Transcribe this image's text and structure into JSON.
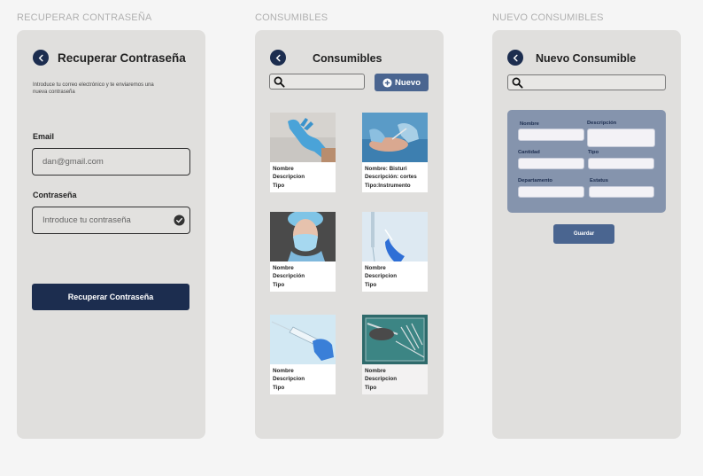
{
  "screens": {
    "recover": {
      "frame_label": "RECUPERAR CONTRASEÑA",
      "title": "Recuperar Contraseña",
      "subtitle_line1": "Introduce tu correo electrónico y te enviaremos una",
      "subtitle_line2": "nueva contraseña",
      "email_label": "Email",
      "email_value": "dan@gmail.com",
      "password_label": "Contraseña",
      "password_placeholder": "Introduce tu contraseña",
      "submit_label": "Recuperar Contraseña"
    },
    "list": {
      "frame_label": "CONSUMIBLES",
      "title": "Consumibles",
      "new_label": "Nuevo",
      "cards": [
        {
          "image": "gloves",
          "line1": "Nombre",
          "line2": "Descripcion",
          "line3": "Tipo"
        },
        {
          "image": "surgery",
          "line1": "Nombre: Bisturi",
          "line2": "Descripción: cortes",
          "line3": "Tipo:Instrumento"
        },
        {
          "image": "mask",
          "line1": "Nombre",
          "line2": "Descripción",
          "line3": "Tipo"
        },
        {
          "image": "iv-drip",
          "line1": "Nombre",
          "line2": "Descripcion",
          "line3": "Tipo"
        },
        {
          "image": "syringe",
          "line1": "Nombre",
          "line2": "Descripcion",
          "line3": "Tipo"
        },
        {
          "image": "instruments",
          "line1": "Nombre",
          "line2": "Descripcion",
          "line3": "Tipo"
        }
      ]
    },
    "create": {
      "frame_label": "NUEVO CONSUMIBLES",
      "title": "Nuevo Consumible",
      "fields": {
        "nombre": "Nombre",
        "descripcion": "Descripción",
        "cantidad": "Cantidad",
        "tipo": "Tipo",
        "departamento": "Departamento",
        "estatus": "Estatus"
      },
      "save_label": "Guardar"
    }
  },
  "colors": {
    "primary": "#1c2d4f",
    "button": "#4a6590",
    "form_panel": "#8594ad",
    "phone_bg": "#e0dfdd"
  }
}
